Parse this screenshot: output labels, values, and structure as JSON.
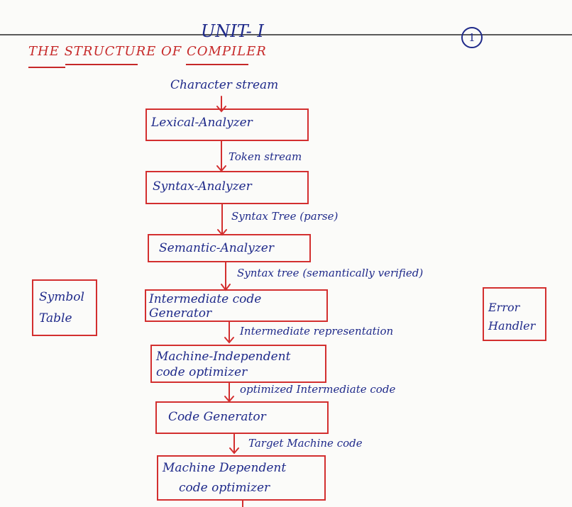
{
  "header": {
    "unit": "UNIT- I",
    "page_number": "1",
    "title": "THE STRUCTURE OF COMPILER"
  },
  "flow": {
    "input": "Character stream",
    "stages": [
      {
        "label": "Lexical-Analyzer"
      },
      {
        "label": "Syntax-Analyzer"
      },
      {
        "label": "Semantic-Analyzer"
      },
      {
        "label": "Intermediate code\nGenerator"
      },
      {
        "label": "Machine-Independent\ncode optimizer"
      },
      {
        "label": "Code Generator"
      },
      {
        "label": "Machine Dependent\ncode optimizer"
      }
    ],
    "edges": [
      "Token stream",
      "Syntax Tree (parse)",
      "Syntax tree (semantically verified)",
      "Intermediate representation",
      "optimized Intermediate code",
      "Target Machine code"
    ]
  },
  "side": {
    "symbol_table": "Symbol\nTable",
    "error_handler": "Error\nHandler"
  },
  "colors": {
    "ink": "#1f2a8a",
    "box": "#d32f2f",
    "title_red": "#c62828",
    "paper": "#fbfbf9"
  }
}
